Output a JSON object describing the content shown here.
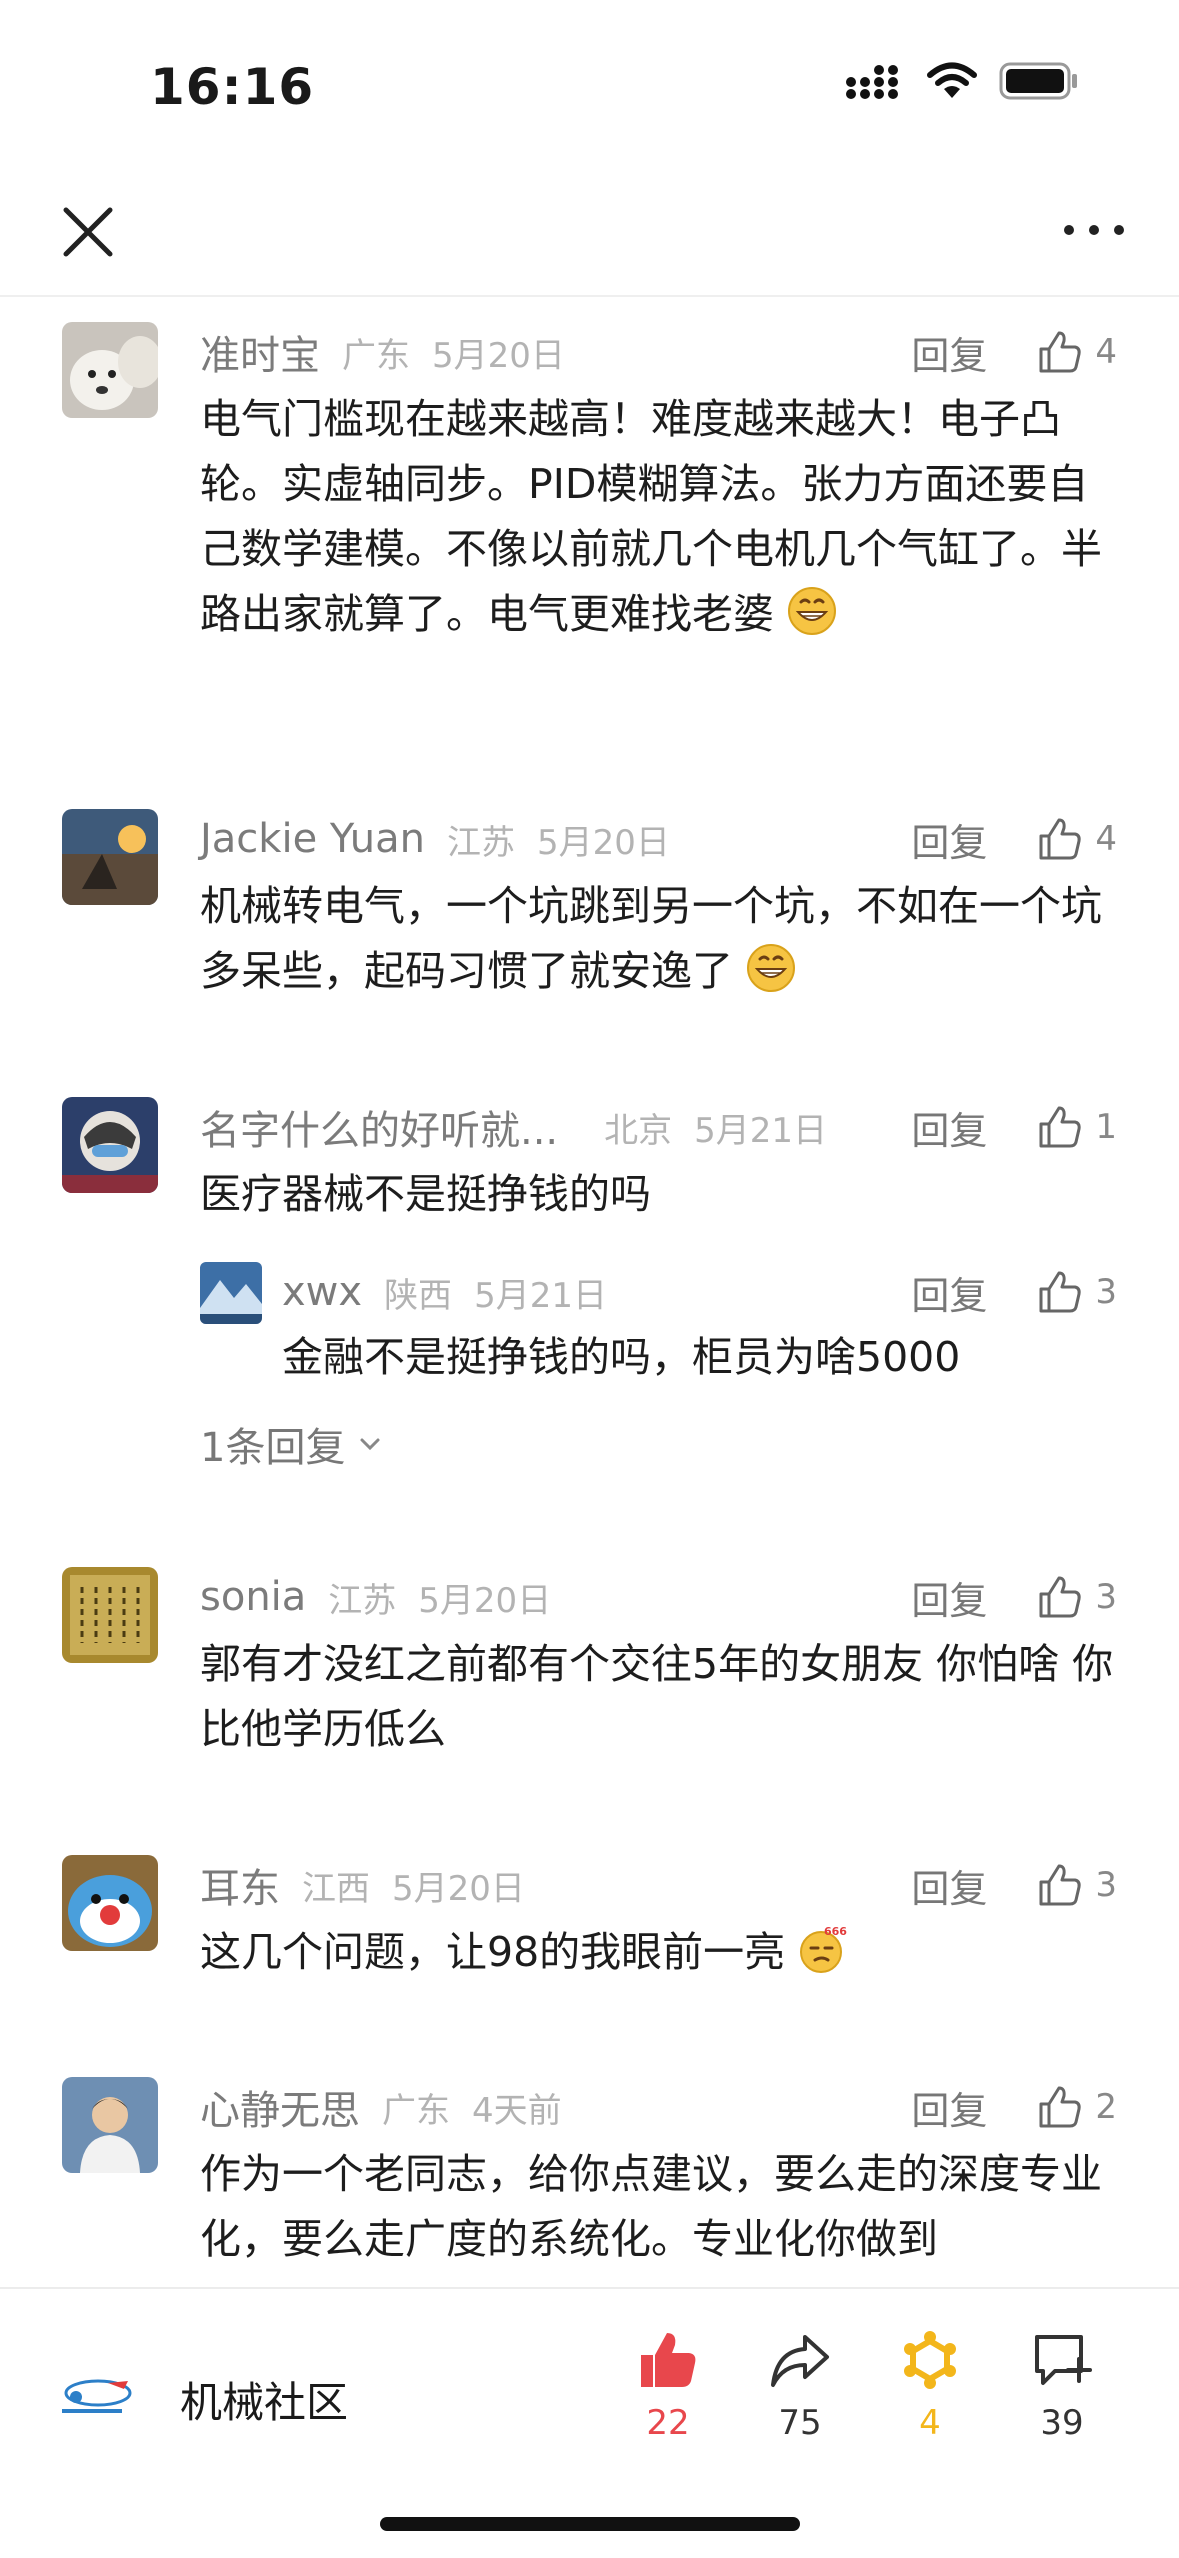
{
  "status_bar": {
    "time": "16:16"
  },
  "nav": {
    "close_icon": "close-icon",
    "more_icon": "more-icon"
  },
  "comments": [
    {
      "username": "准时宝",
      "region": "广东",
      "date": "5月20日",
      "reply_label": "回复",
      "likes": "4",
      "text": "电气门槛现在越来越高！难度越来越大！电子凸轮。实虚轴同步。PID模糊算法。张力方面还要自己数学建模。不像以前就几个电机几个气缸了。半路出家就算了。电气更难找老婆",
      "emoji": "grinning-emoji"
    },
    {
      "username": "Jackie Yuan",
      "region": "江苏",
      "date": "5月20日",
      "reply_label": "回复",
      "likes": "4",
      "text": "机械转电气，一个坑跳到另一个坑，不如在一个坑多呆些，起码习惯了就安逸了",
      "emoji": "grinning-emoji"
    },
    {
      "username": "名字什么的好听就...",
      "region": "北京",
      "date": "5月21日",
      "reply_label": "回复",
      "likes": "1",
      "text": "医疗器械不是挺挣钱的吗",
      "sub_reply": {
        "username": "xwx",
        "region": "陕西",
        "date": "5月21日",
        "reply_label": "回复",
        "likes": "3",
        "text": "金融不是挺挣钱的吗，柜员为啥5000"
      },
      "expand_label": "1条回复"
    },
    {
      "username": "sonia",
      "region": "江苏",
      "date": "5月20日",
      "reply_label": "回复",
      "likes": "3",
      "text": "郭有才没红之前都有个交往5年的女朋友 你怕啥 你比他学历低么"
    },
    {
      "username": "耳东",
      "region": "江西",
      "date": "5月20日",
      "reply_label": "回复",
      "likes": "3",
      "text": "这几个问题，让98的我眼前一亮",
      "emoji": "666-emoji",
      "emoji_text": "666"
    },
    {
      "username": "心静无思",
      "region": "广东",
      "date": "4天前",
      "reply_label": "回复",
      "likes": "2",
      "text": "作为一个老同志，给你点建议，要么走的深度专业化，要么走广度的系统化。专业化你做到"
    }
  ],
  "bottom_bar": {
    "community_name": "机械社区",
    "like_count": "22",
    "share_count": "75",
    "favorite_count": "4",
    "comment_count": "39",
    "colors": {
      "like": "#e8474c",
      "favorite": "#f3b61b",
      "neutral": "#333333"
    }
  }
}
